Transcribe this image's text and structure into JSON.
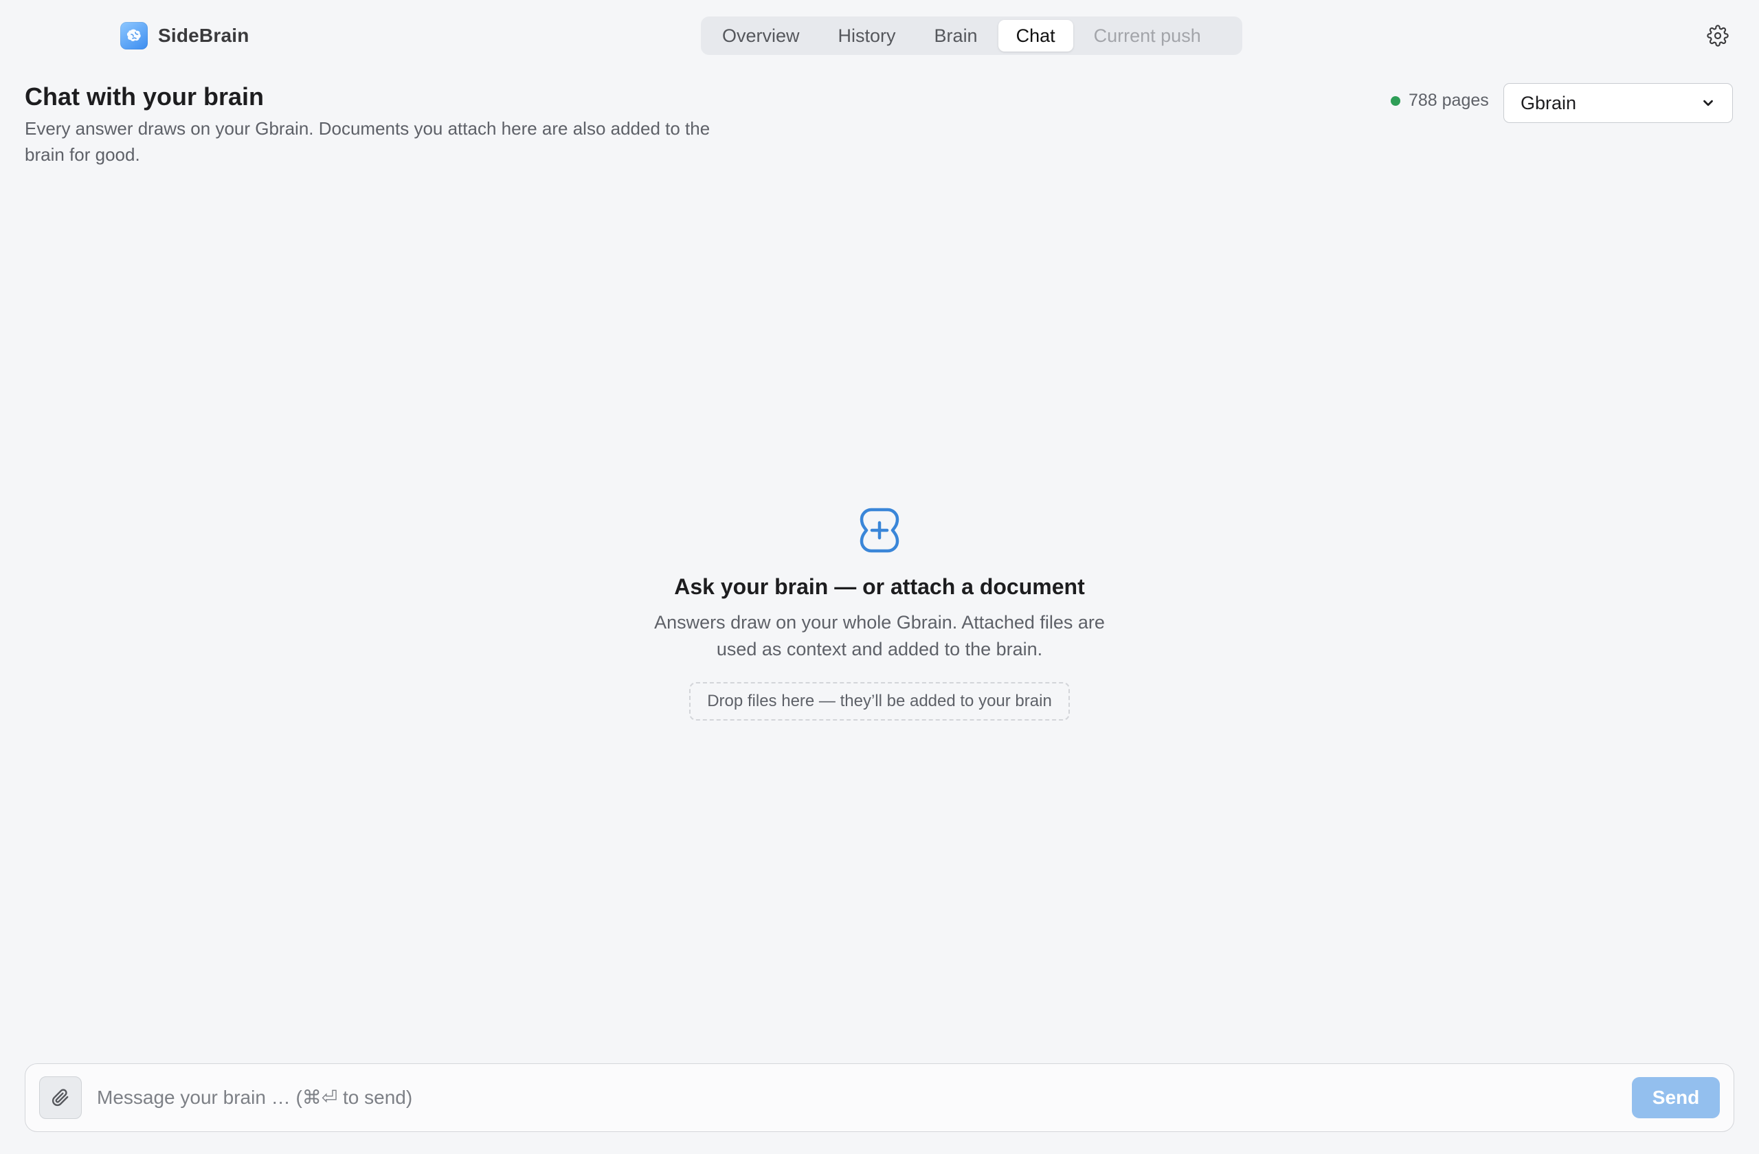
{
  "app": {
    "name": "SideBrain",
    "logo_icon": "brain-logo-icon"
  },
  "nav": {
    "tabs": [
      {
        "label": "Overview",
        "state": "default"
      },
      {
        "label": "History",
        "state": "default"
      },
      {
        "label": "Brain",
        "state": "default"
      },
      {
        "label": "Chat",
        "state": "active"
      },
      {
        "label": "Current push",
        "state": "disabled"
      }
    ],
    "settings_icon": "gear-icon"
  },
  "header": {
    "title": "Chat with your brain",
    "subtitle": "Every answer draws on your Gbrain. Documents you attach here are also added to the brain for good."
  },
  "status": {
    "text": "788 pages",
    "color": "#2e9e57"
  },
  "brain_select": {
    "selected": "Gbrain"
  },
  "empty_state": {
    "icon": "brain-plus-icon",
    "title": "Ask your brain — or attach a document",
    "description": "Answers draw on your whole Gbrain. Attached files are used as context and added to the brain.",
    "dropzone": "Drop files here — they’ll be added to your brain"
  },
  "composer": {
    "attach_icon": "paperclip-icon",
    "placeholder": "Message your brain … (⌘⏎ to send)",
    "value": "",
    "send_label": "Send"
  },
  "colors": {
    "accent": "#3a86d8",
    "send_disabled": "#93bfee",
    "background": "#f5f6f8"
  }
}
